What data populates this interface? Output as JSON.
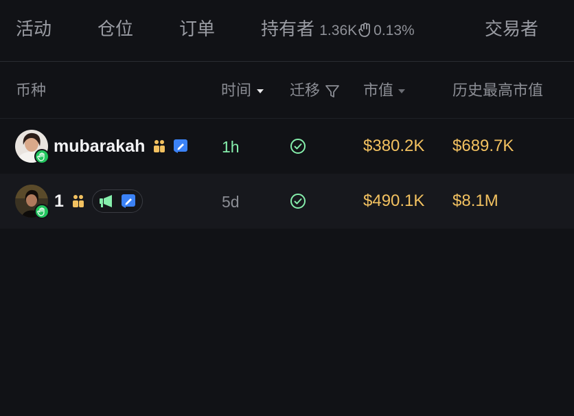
{
  "tabs": {
    "activity": "活动",
    "positions": "仓位",
    "orders": "订单",
    "holders": "持有者",
    "holders_count": "1.36K",
    "holders_pct": "0.13%",
    "traders": "交易者"
  },
  "table": {
    "headers": {
      "token": "币种",
      "time": "时间",
      "migrate": "迁移",
      "market_cap": "市值",
      "ath_market_cap": "历史最高市值"
    },
    "rows": [
      {
        "name": "mubarakah",
        "time": "1h",
        "market_cap": "$380.2K",
        "ath_market_cap": "$689.7K"
      },
      {
        "name": "1",
        "time": "5d",
        "market_cap": "$490.1K",
        "ath_market_cap": "$8.1M"
      }
    ]
  },
  "colors": {
    "background": "#111216",
    "accent_gold": "#f2c160",
    "recent_green": "#86efac",
    "badge_blue": "#3b82f6",
    "badge_green": "#22c55e"
  },
  "icons": {
    "holders": "grab-hand-icon",
    "time_sort": "caret-down-icon",
    "migrate_filter": "funnel-icon",
    "market_cap_sort": "caret-down-icon",
    "avatar_badge": "hand-wave-icon",
    "dev_badge": "people-icon",
    "edit_badge": "pencil-badge-icon",
    "promo_badge": "megaphone-icon",
    "migrated": "check-circle-icon"
  }
}
